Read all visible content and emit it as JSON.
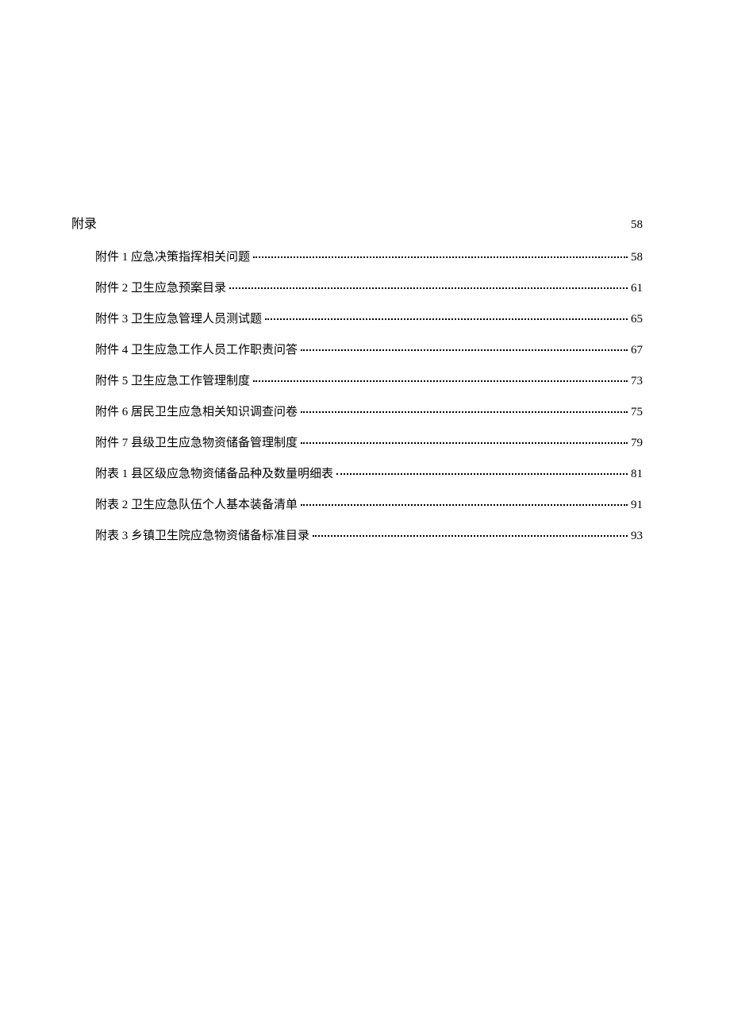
{
  "section": {
    "title": "附录",
    "page": "58"
  },
  "toc": [
    {
      "label": "附件 1 应急决策指挥相关问题",
      "page": "58"
    },
    {
      "label": "附件 2 卫生应急预案目录",
      "page": "61"
    },
    {
      "label": "附件 3 卫生应急管理人员测试题",
      "page": "65"
    },
    {
      "label": "附件 4 卫生应急工作人员工作职责问答",
      "page": "67"
    },
    {
      "label": "附件 5 卫生应急工作管理制度",
      "page": "73"
    },
    {
      "label": "附件 6 居民卫生应急相关知识调查问卷",
      "page": "75"
    },
    {
      "label": "附件 7 县级卫生应急物资储备管理制度",
      "page": "79"
    },
    {
      "label": "附表 1 县区级应急物资储备品种及数量明细表",
      "page": "81"
    },
    {
      "label": "附表 2 卫生应急队伍个人基本装备清单",
      "page": "91"
    },
    {
      "label": "附表 3 乡镇卫生院应急物资储备标准目录",
      "page": "93"
    }
  ]
}
